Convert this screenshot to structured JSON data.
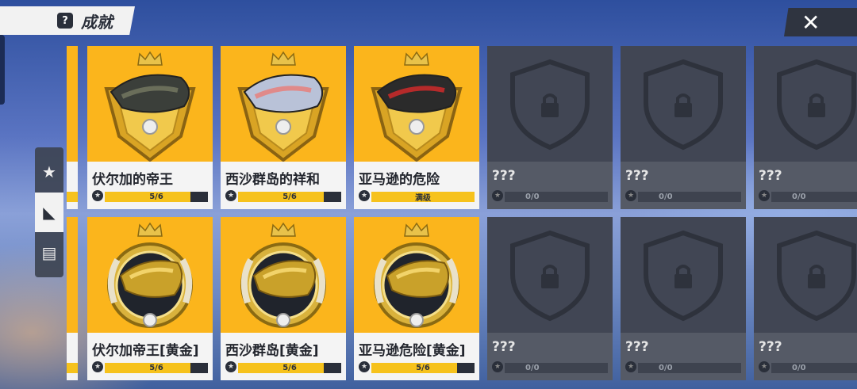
{
  "header": {
    "title": "成就",
    "help_icon": "?",
    "close_icon": "✕"
  },
  "side_tabs": [
    {
      "icon": "star-badge-icon",
      "glyph": "★"
    },
    {
      "icon": "fish-fin-icon",
      "glyph": "◣"
    },
    {
      "icon": "card-book-icon",
      "glyph": "▤"
    }
  ],
  "row1": [
    {
      "name": "伏尔加的帝王",
      "progress_text": "5/6",
      "progress": 0.83,
      "locked": false
    },
    {
      "name": "西沙群岛的祥和",
      "progress_text": "5/6",
      "progress": 0.83,
      "locked": false
    },
    {
      "name": "亚马逊的危险",
      "progress_text": "满级",
      "progress": 1.0,
      "locked": false
    },
    {
      "name": "???",
      "progress_text": "0/0",
      "progress": 0,
      "locked": true
    },
    {
      "name": "???",
      "progress_text": "0/0",
      "progress": 0,
      "locked": true
    },
    {
      "name": "???",
      "progress_text": "0/0",
      "progress": 0,
      "locked": true
    }
  ],
  "row2": [
    {
      "name": "伏尔加帝王[黄金]",
      "progress_text": "5/6",
      "progress": 0.83,
      "locked": false
    },
    {
      "name": "西沙群岛[黄金]",
      "progress_text": "5/6",
      "progress": 0.83,
      "locked": false
    },
    {
      "name": "亚马逊危险[黄金]",
      "progress_text": "5/6",
      "progress": 0.83,
      "locked": false
    },
    {
      "name": "???",
      "progress_text": "0/0",
      "progress": 0,
      "locked": true
    },
    {
      "name": "???",
      "progress_text": "0/0",
      "progress": 0,
      "locked": true
    },
    {
      "name": "???",
      "progress_text": "0/0",
      "progress": 0,
      "locked": true
    }
  ],
  "colors": {
    "unlocked_bg": "#fbb51c",
    "locked_bg": "#414654",
    "progress_fill": "#f6c21c",
    "dark": "#2a2f3a"
  }
}
